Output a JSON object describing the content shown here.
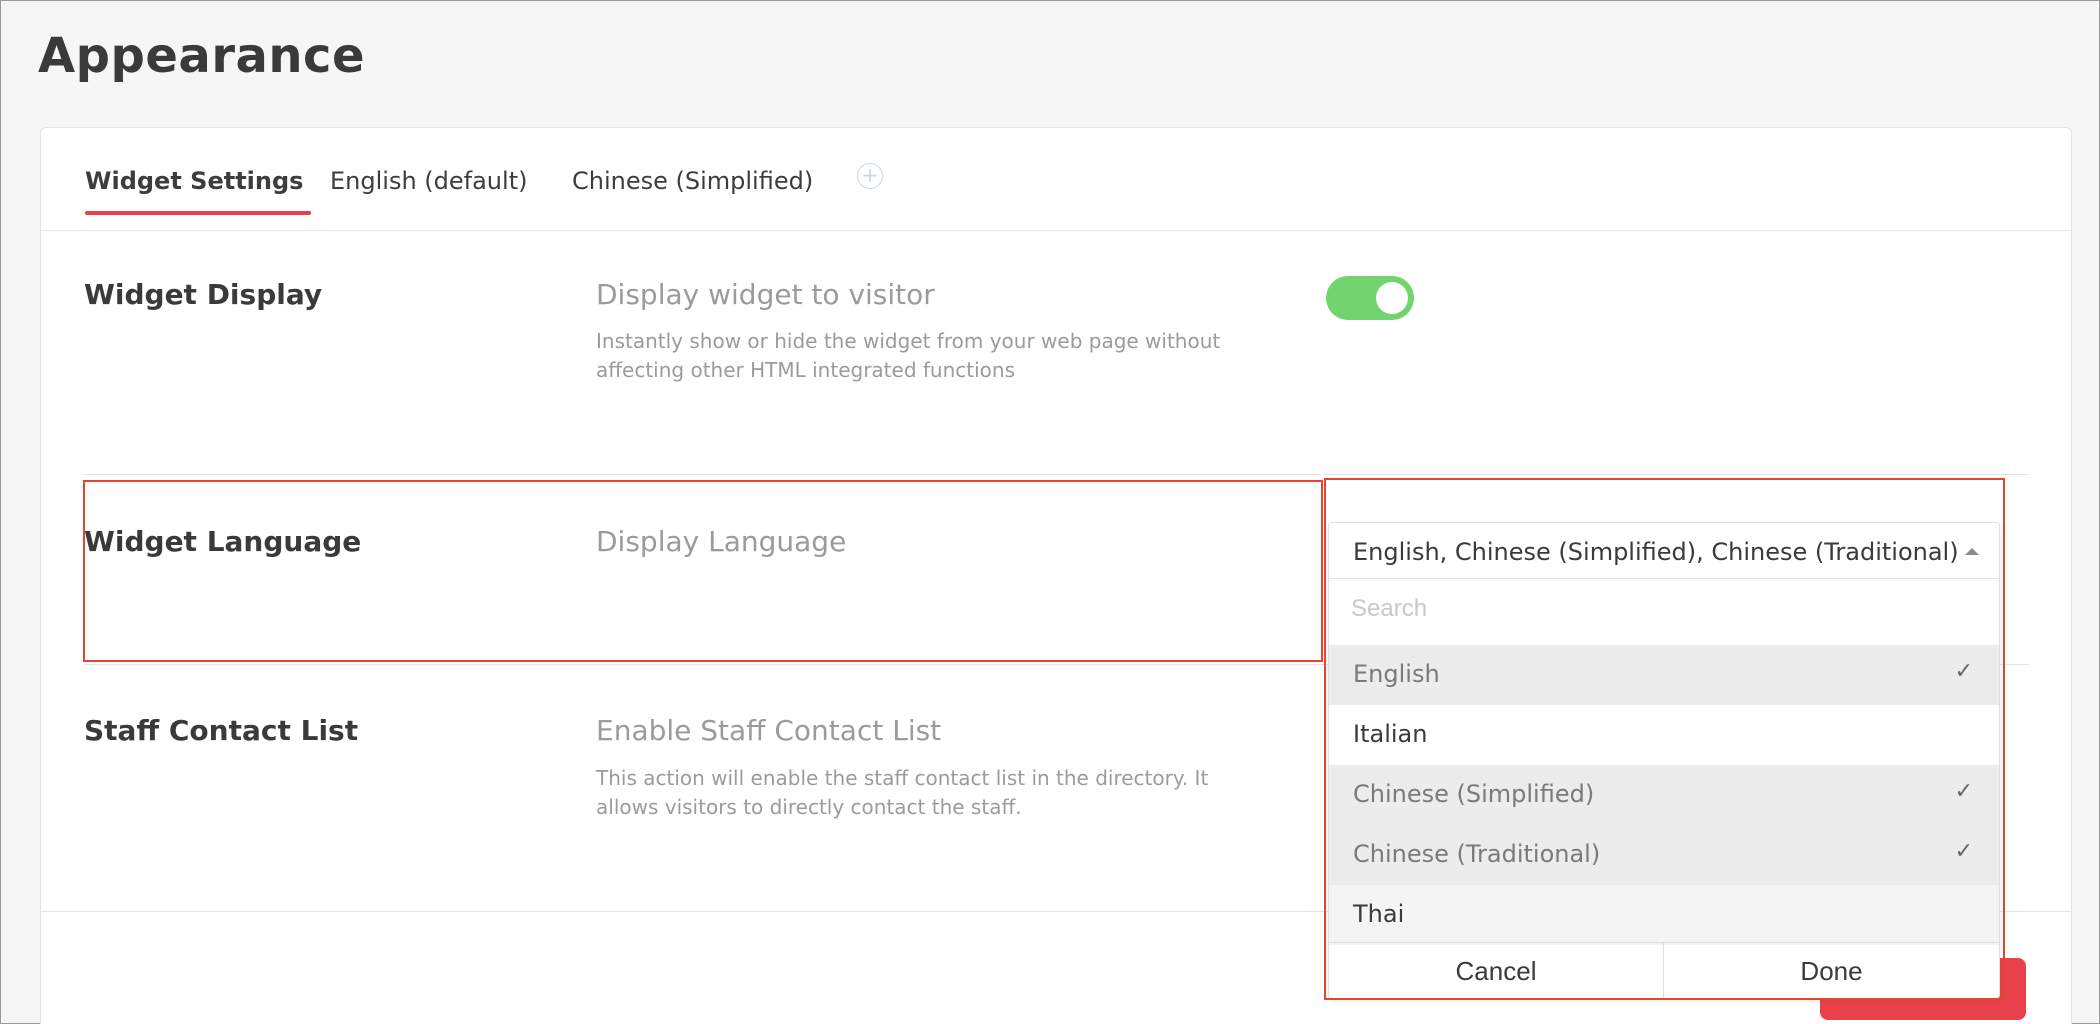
{
  "page": {
    "title": "Appearance"
  },
  "tabs": [
    {
      "label": "Widget Settings",
      "active": true
    },
    {
      "label": "English (default)",
      "active": false
    },
    {
      "label": "Chinese (Simplified)",
      "active": false
    }
  ],
  "add_tab_icon": "plus-circle-icon",
  "rows": {
    "display": {
      "label": "Widget Display",
      "title": "Display widget to visitor",
      "description": "Instantly show or hide the widget from your web page without affecting other HTML integrated functions",
      "toggle_on": true
    },
    "language": {
      "label": "Widget Language",
      "title": "Display Language"
    },
    "staff": {
      "label": "Staff Contact List",
      "title": "Enable Staff Contact List",
      "description": "This action will enable the staff contact list in the directory. It allows visitors to directly contact the staff."
    }
  },
  "dropdown": {
    "selected_text": "English, Chinese (Simplified), Chinese (Traditional)",
    "search_placeholder": "Search",
    "options": [
      {
        "label": "English",
        "checked": true
      },
      {
        "label": "Italian",
        "checked": false
      },
      {
        "label": "Chinese (Simplified)",
        "checked": true
      },
      {
        "label": "Chinese (Traditional)",
        "checked": true
      },
      {
        "label": "Thai",
        "checked": false
      }
    ],
    "check_glyph": "✓",
    "cancel_label": "Cancel",
    "done_label": "Done"
  },
  "colors": {
    "accent": "#e8414c",
    "toggle_on": "#73d36f",
    "highlight_box": "#e8432e"
  }
}
